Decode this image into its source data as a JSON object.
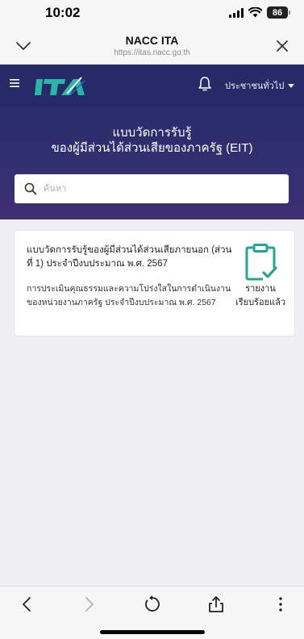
{
  "status_bar": {
    "time": "10:02",
    "battery": "86",
    "icons": [
      "signal-icon",
      "wifi-icon",
      "battery-icon"
    ]
  },
  "browser": {
    "title": "NACC ITA",
    "url": "https://itas.nacc.go.th",
    "icons": [
      "chevron-down-icon",
      "close-icon"
    ]
  },
  "site": {
    "logo_text": "ITA",
    "user_menu": "ประชาชนทั่วไป",
    "icons": [
      "menu-icon",
      "bell-icon"
    ],
    "brand_color": "#262a66",
    "accent_color": "#21a98f"
  },
  "banner": {
    "title_line1": "แบบวัดการรับรู้",
    "title_line2": "ของผู้มีส่วนได้ส่วนเสียของภาครัฐ (EIT)"
  },
  "search": {
    "placeholder": "ค้นหา",
    "value": ""
  },
  "card": {
    "title": "แบบวัดการรับรู้ของผู้มีส่วนได้ส่วนเสียภายนอก (ส่วนที่ 1) ประจำปีงบประมาณ พ.ศ. 2567",
    "description": "การประเมินคุณธรรมและความโปร่งใสในการดำเนินงานของหน่วยงานภาครัฐ ประจำปีงบประมาณ พ.ศ. 2567",
    "status": "รายงานเรียบร้อยแล้ว",
    "icon": "clipboard-check-icon"
  },
  "toolbar": {
    "icons": [
      "back-icon",
      "forward-icon",
      "reload-icon",
      "share-icon",
      "more-icon"
    ]
  }
}
